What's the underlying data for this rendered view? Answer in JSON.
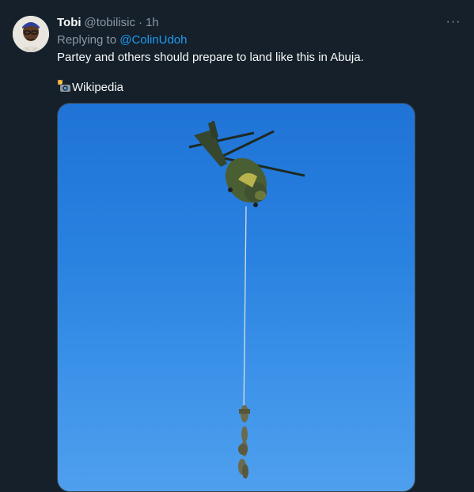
{
  "tweet": {
    "author": {
      "display_name": "Tobi",
      "handle": "@tobilisic",
      "separator": "·",
      "time": "1h",
      "avatar_icon": "user-avatar"
    },
    "more_icon": "more-horizontal-icon",
    "more_label": "···",
    "reply": {
      "prefix": "Replying to",
      "mention": "@ColinUdoh"
    },
    "text": "Partey and others should prepare to land like this in Abuja.",
    "source": {
      "emoji_icon": "camera-flash-icon",
      "label": "Wikipedia"
    },
    "media": {
      "description_icon": "helicopter-rappel-photo",
      "sky_color": "#2a82e0"
    }
  },
  "colors": {
    "background": "#15202b",
    "text_primary": "#f7f9f9",
    "text_secondary": "#8b98a5",
    "link": "#1d9bf0"
  }
}
